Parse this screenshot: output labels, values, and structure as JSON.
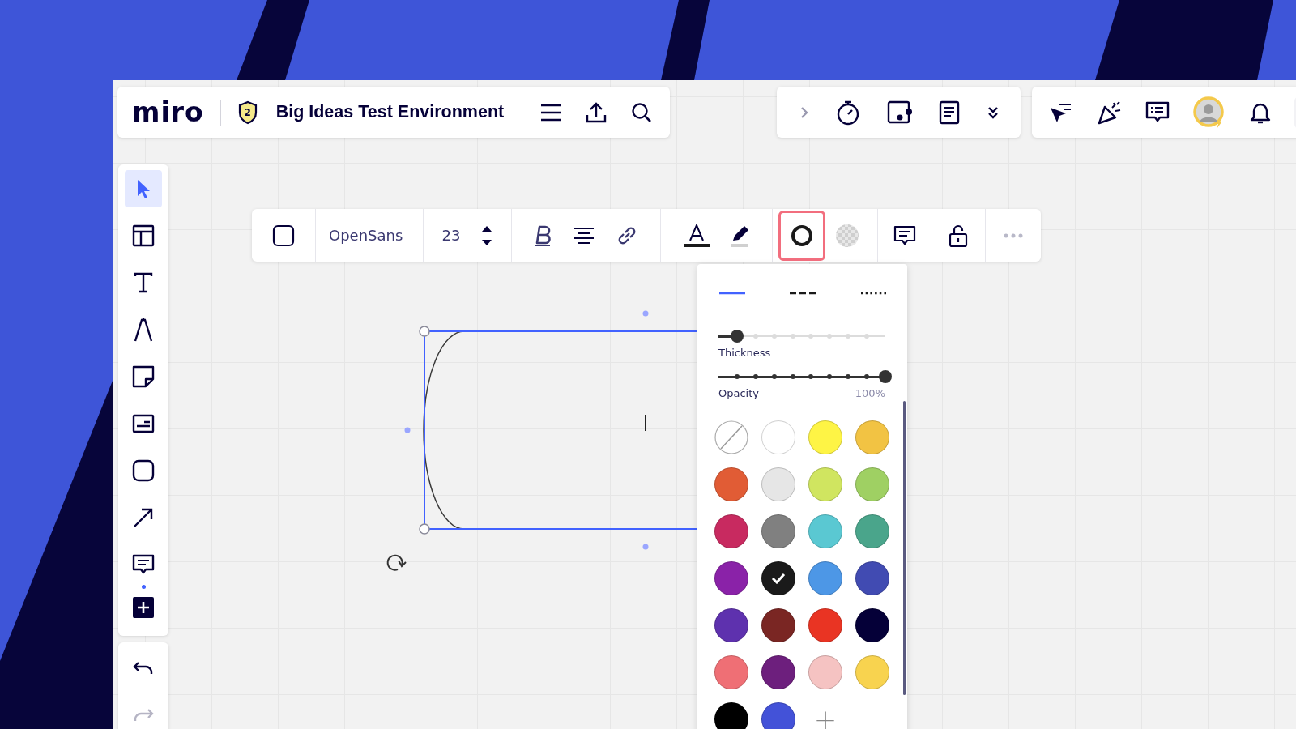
{
  "header": {
    "logo": "miro",
    "board_badge": "2",
    "board_title": "Big Ideas Test Environment"
  },
  "left_toolbar": {
    "tools": [
      {
        "kind": "select",
        "selected": true
      },
      {
        "kind": "templates",
        "selected": false
      },
      {
        "kind": "text",
        "selected": false
      },
      {
        "kind": "pen",
        "selected": false
      },
      {
        "kind": "sticky",
        "selected": false
      },
      {
        "kind": "card",
        "selected": false
      },
      {
        "kind": "shape",
        "selected": false
      },
      {
        "kind": "arrow",
        "selected": false
      },
      {
        "kind": "comment",
        "selected": false
      },
      {
        "kind": "more",
        "selected": false
      }
    ],
    "history": [
      {
        "kind": "undo",
        "disabled": false
      },
      {
        "kind": "redo",
        "disabled": true
      }
    ]
  },
  "context_toolbar": {
    "font": "OpenSans",
    "font_size": "23",
    "border_button": {
      "selected": true
    }
  },
  "stroke_popup": {
    "line_styles": [
      {
        "kind": "solid",
        "selected": true
      },
      {
        "kind": "dashed",
        "selected": false
      },
      {
        "kind": "dotted",
        "selected": false
      }
    ],
    "thickness": {
      "label": "Thickness",
      "level": 0.11
    },
    "opacity": {
      "label": "Opacity",
      "level": 1,
      "reading": "100%"
    },
    "swatches": [
      {
        "kind": "none",
        "selected": false
      },
      {
        "kind": "color",
        "color": "#ffffff",
        "selected": false
      },
      {
        "kind": "color",
        "color": "#fef445",
        "selected": false
      },
      {
        "kind": "color",
        "color": "#f2c343",
        "selected": false
      },
      {
        "kind": "color",
        "color": "#e15c35",
        "selected": false
      },
      {
        "kind": "color",
        "color": "#e6e6e6",
        "selected": false
      },
      {
        "kind": "color",
        "color": "#d0e560",
        "selected": false
      },
      {
        "kind": "color",
        "color": "#9fd063",
        "selected": false
      },
      {
        "kind": "color",
        "color": "#c82a60",
        "selected": false
      },
      {
        "kind": "color",
        "color": "#808080",
        "selected": false
      },
      {
        "kind": "color",
        "color": "#5ac8d2",
        "selected": false
      },
      {
        "kind": "color",
        "color": "#4aa58b",
        "selected": false
      },
      {
        "kind": "color",
        "color": "#8a22a8",
        "selected": false
      },
      {
        "kind": "color",
        "color": "#1a1a1a",
        "selected": true
      },
      {
        "kind": "color",
        "color": "#4d97e6",
        "selected": false
      },
      {
        "kind": "color",
        "color": "#414bb2",
        "selected": false
      },
      {
        "kind": "color",
        "color": "#5e31ae",
        "selected": false
      },
      {
        "kind": "color",
        "color": "#7a2623",
        "selected": false
      },
      {
        "kind": "color",
        "color": "#e93423",
        "selected": false
      },
      {
        "kind": "color",
        "color": "#050038",
        "selected": false
      },
      {
        "kind": "color",
        "color": "#ef6f75",
        "selected": false
      },
      {
        "kind": "color",
        "color": "#6d1f7d",
        "selected": false
      },
      {
        "kind": "color",
        "color": "#f5c3c2",
        "selected": false
      },
      {
        "kind": "color",
        "color": "#f8d34f",
        "selected": false
      },
      {
        "kind": "color",
        "color": "#000000",
        "selected": false
      },
      {
        "kind": "color",
        "color": "#4352d8",
        "selected": false
      }
    ],
    "add_label": "+"
  }
}
